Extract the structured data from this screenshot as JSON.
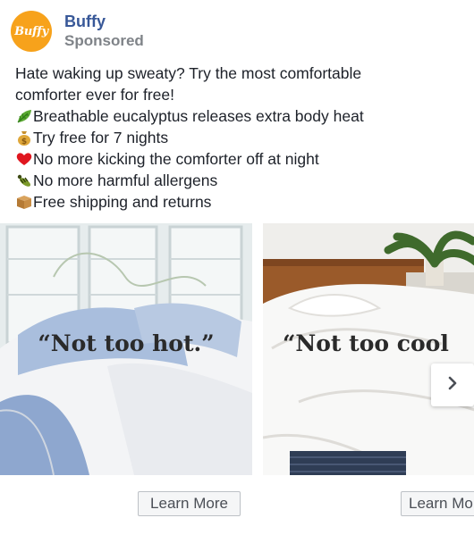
{
  "ad": {
    "avatar_text": "Buffy",
    "page_name": "Buffy",
    "sponsored_label": "Sponsored"
  },
  "body": {
    "lines": [
      {
        "icon": "",
        "text": "Hate waking up sweaty? Try the most comfortable"
      },
      {
        "icon": "",
        "text": "comforter ever for free!"
      },
      {
        "icon": "leaf-icon",
        "text": "Breathable eucalyptus releases extra body heat"
      },
      {
        "icon": "money-bag-icon",
        "text": "Try free for 7 nights"
      },
      {
        "icon": "heart-icon",
        "text": "No more kicking the comforter off at night"
      },
      {
        "icon": "bug-icon",
        "text": "No more harmful allergens"
      },
      {
        "icon": "package-icon",
        "text": "Free shipping and returns"
      }
    ]
  },
  "carousel": {
    "cards": [
      {
        "quote": "“Not too hot.”",
        "cta": "Learn More"
      },
      {
        "quote": "“Not too cool",
        "cta": "Learn More"
      }
    ],
    "next_icon": "chevron-right-icon"
  },
  "colors": {
    "brand_orange": "#f7a21b",
    "page_name_blue": "#385898",
    "sponsored_gray": "#7f8388"
  }
}
